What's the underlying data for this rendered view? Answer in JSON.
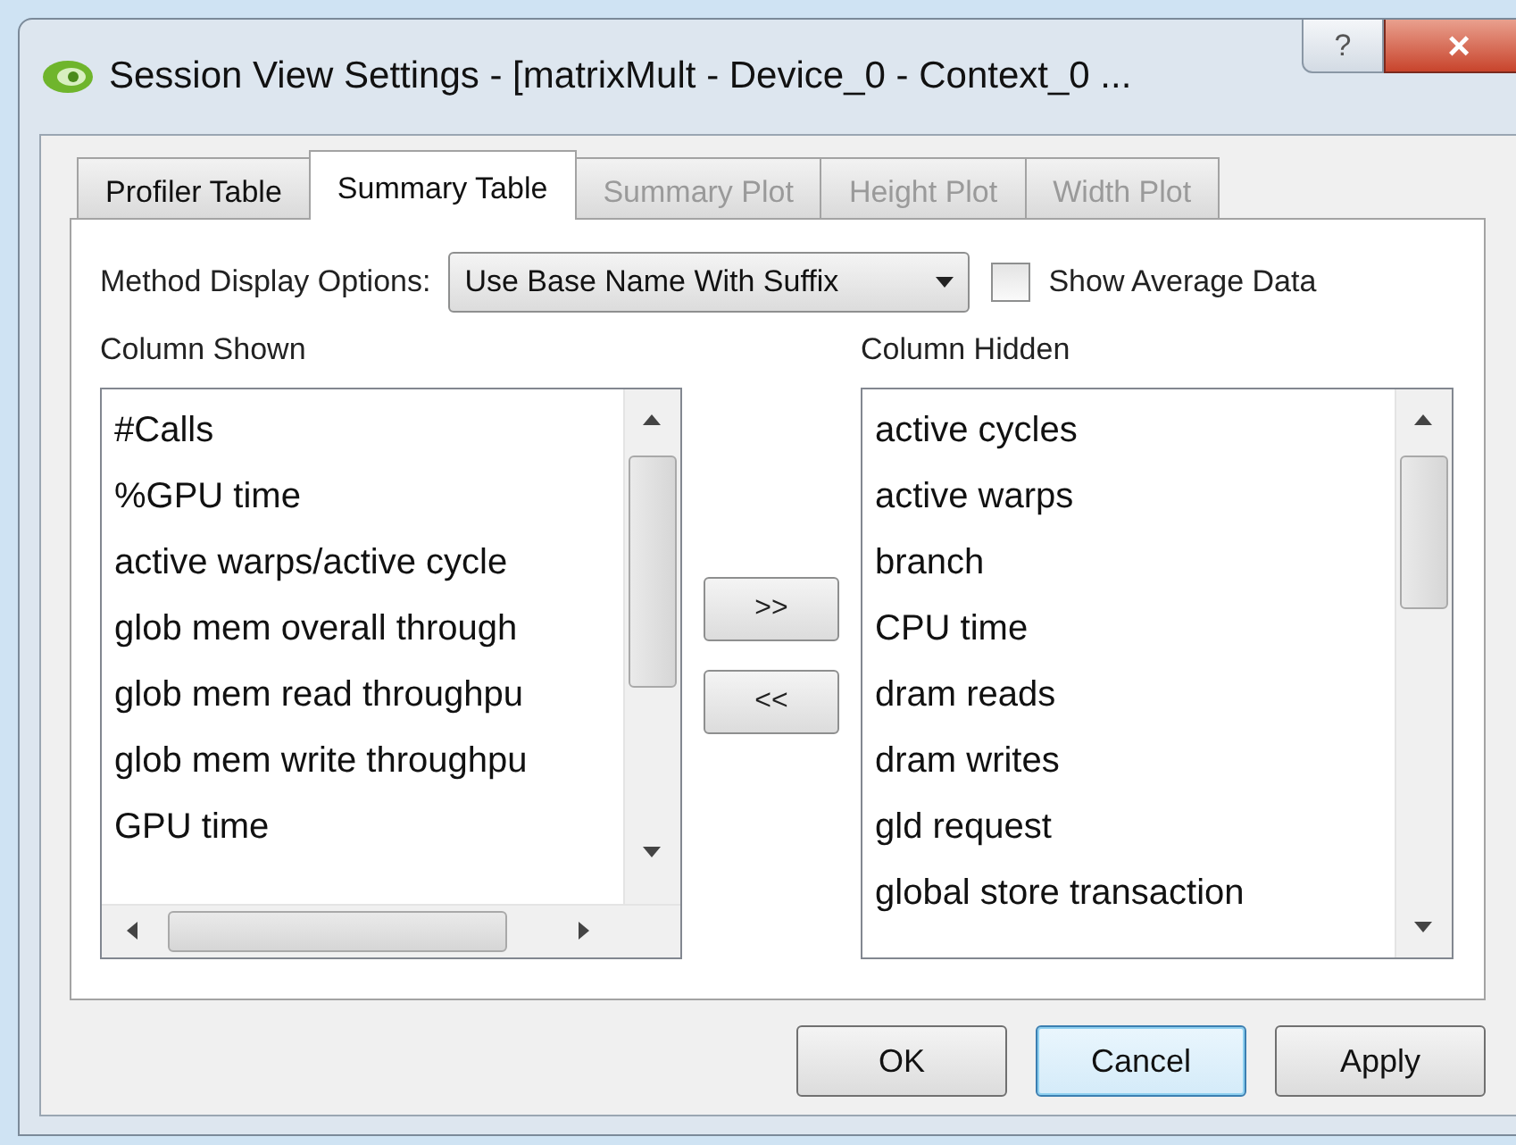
{
  "window": {
    "title": "Session View Settings  - [matrixMult - Device_0 - Context_0 ...",
    "help_button": "?",
    "close_button": "×"
  },
  "tabs": [
    {
      "label": "Profiler Table",
      "selected": false,
      "disabled": false
    },
    {
      "label": "Summary Table",
      "selected": true,
      "disabled": false
    },
    {
      "label": "Summary Plot",
      "selected": false,
      "disabled": true
    },
    {
      "label": "Height Plot",
      "selected": false,
      "disabled": true
    },
    {
      "label": "Width Plot",
      "selected": false,
      "disabled": true
    }
  ],
  "method_display_options": {
    "label": "Method Display Options:",
    "value": "Use Base Name With Suffix"
  },
  "show_average_data": {
    "label": "Show Average Data",
    "checked": false
  },
  "column_shown": {
    "label": "Column Shown",
    "items": [
      "#Calls",
      "%GPU time",
      "active warps/active cycle",
      "glob mem overall through",
      "glob mem read throughpu",
      "glob mem write throughpu",
      "GPU time"
    ]
  },
  "move_buttons": [
    ">>",
    "<<"
  ],
  "column_hidden": {
    "label": "Column Hidden",
    "items": [
      "active cycles",
      "active warps",
      "branch",
      "CPU time",
      "dram reads",
      "dram writes",
      "gld request",
      "global store transaction"
    ]
  },
  "buttons": [
    {
      "label": "OK",
      "default": false
    },
    {
      "label": "Cancel",
      "default": true
    },
    {
      "label": "Apply",
      "default": false
    }
  ]
}
